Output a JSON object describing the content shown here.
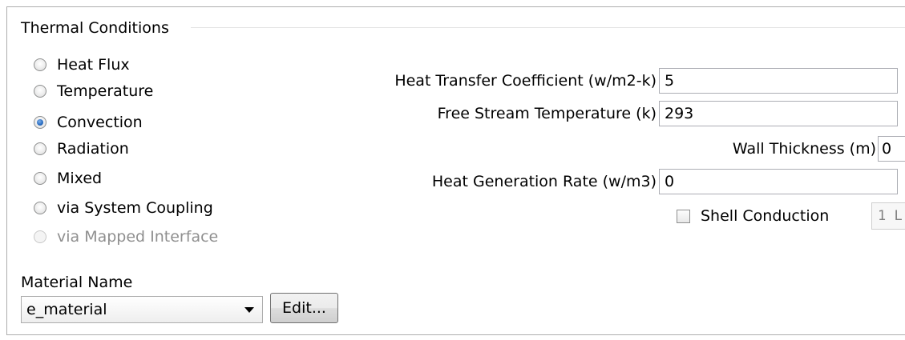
{
  "thermal_conditions": {
    "title": "Thermal Conditions",
    "options": [
      {
        "label": "Heat Flux",
        "checked": false,
        "disabled": false
      },
      {
        "label": "Temperature",
        "checked": false,
        "disabled": false
      },
      {
        "label": "Convection",
        "checked": true,
        "disabled": false
      },
      {
        "label": "Radiation",
        "checked": false,
        "disabled": false
      },
      {
        "label": "Mixed",
        "checked": false,
        "disabled": false
      },
      {
        "label": "via System Coupling",
        "checked": false,
        "disabled": false
      },
      {
        "label": "via Mapped Interface",
        "checked": false,
        "disabled": true
      }
    ]
  },
  "fields": {
    "htc": {
      "label": "Heat Transfer Coefficient (w/m2-k)",
      "value": "5"
    },
    "free_stream_temp": {
      "label": "Free Stream Temperature (k)",
      "value": "293"
    },
    "wall_thickness": {
      "label": "Wall Thickness (m)",
      "value": "0"
    },
    "heat_gen_rate": {
      "label": "Heat Generation Rate (w/m3)",
      "value": "0"
    }
  },
  "shell_conduction": {
    "label": "Shell Conduction",
    "checked": false,
    "layers_value": "1 L"
  },
  "material": {
    "title": "Material Name",
    "selected": "e_material",
    "edit_label": "Edit..."
  }
}
